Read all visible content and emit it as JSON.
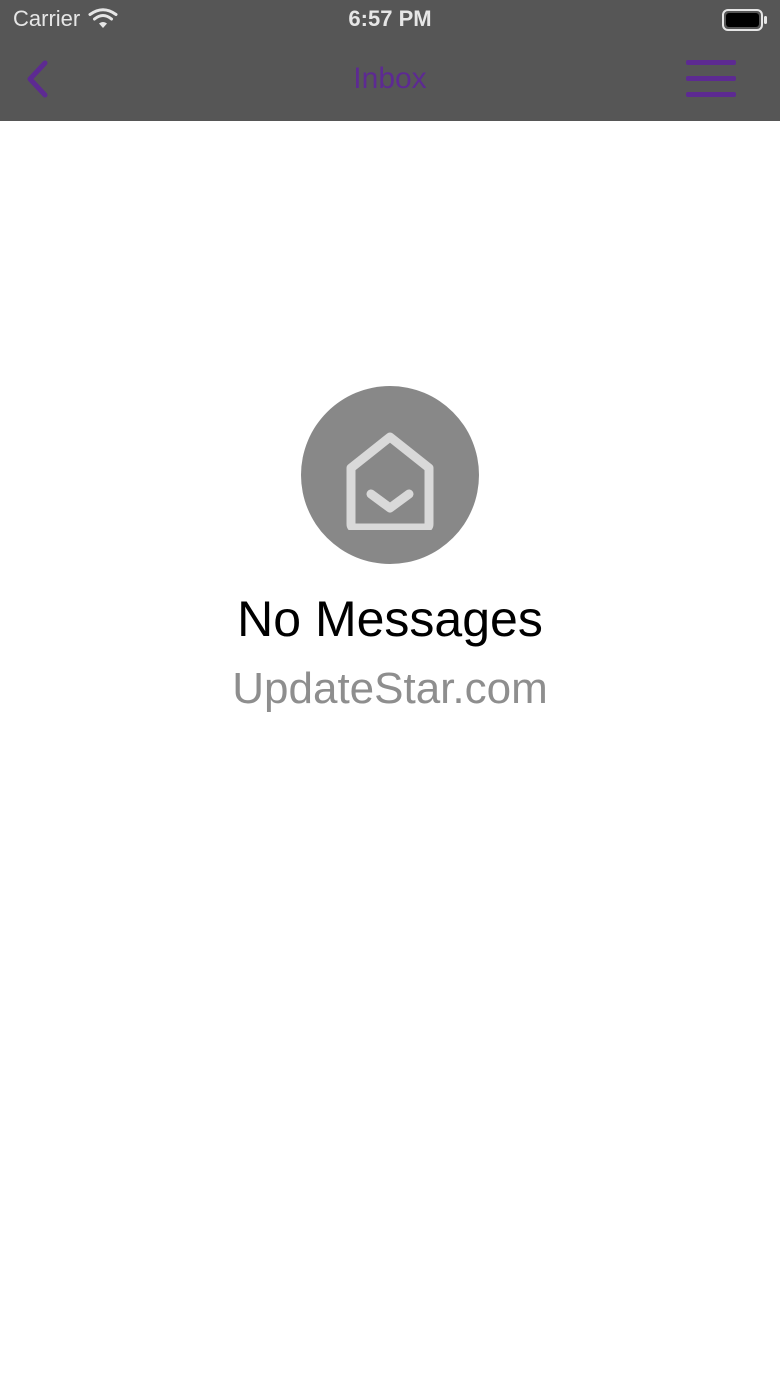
{
  "status_bar": {
    "carrier": "Carrier",
    "time": "6:57 PM"
  },
  "nav": {
    "title": "Inbox",
    "back_icon": "chevron-left-icon",
    "menu_icon": "hamburger-menu-icon"
  },
  "empty_state": {
    "icon": "open-envelope-icon",
    "title": "No Messages",
    "subtitle": "UpdateStar.com"
  },
  "colors": {
    "header_background": "#565656",
    "accent": "#5d2a92",
    "icon_circle": "#888888",
    "subtitle_text": "#8e8e8e"
  }
}
